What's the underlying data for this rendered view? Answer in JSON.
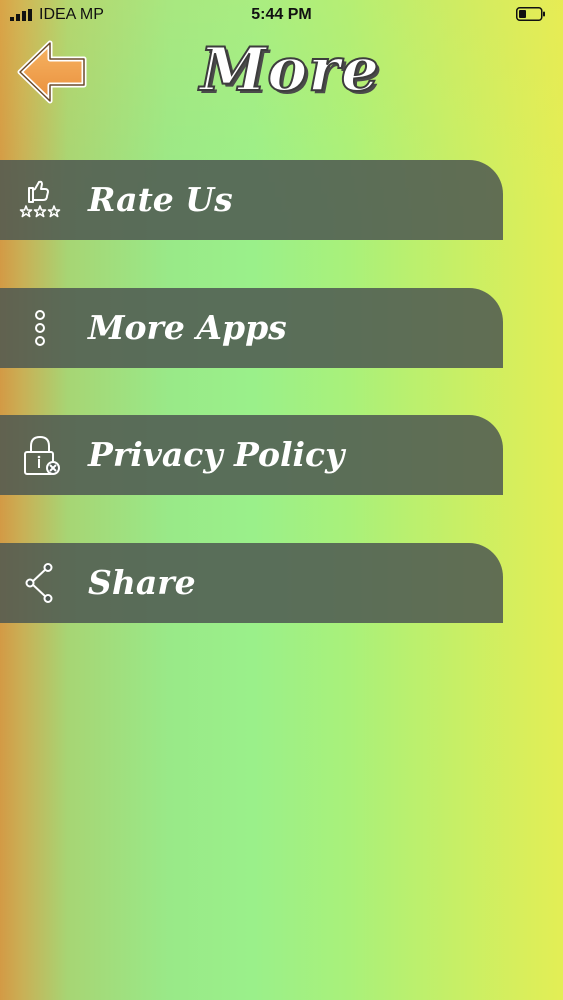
{
  "status_bar": {
    "carrier": "IDEA MP",
    "time": "5:44 PM"
  },
  "header": {
    "title": "More",
    "back_icon": "arrow-left-icon"
  },
  "menu": {
    "items": [
      {
        "label": "Rate Us",
        "icon": "thumbs-up-stars-icon"
      },
      {
        "label": "More Apps",
        "icon": "more-vertical-icon"
      },
      {
        "label": "Privacy Policy",
        "icon": "lock-icon"
      },
      {
        "label": "Share",
        "icon": "share-icon"
      }
    ]
  },
  "colors": {
    "menu_background": "#4e5852",
    "menu_text": "#ffffff",
    "back_arrow": "#f0a24e",
    "title_outline": "#3d3d3d"
  }
}
